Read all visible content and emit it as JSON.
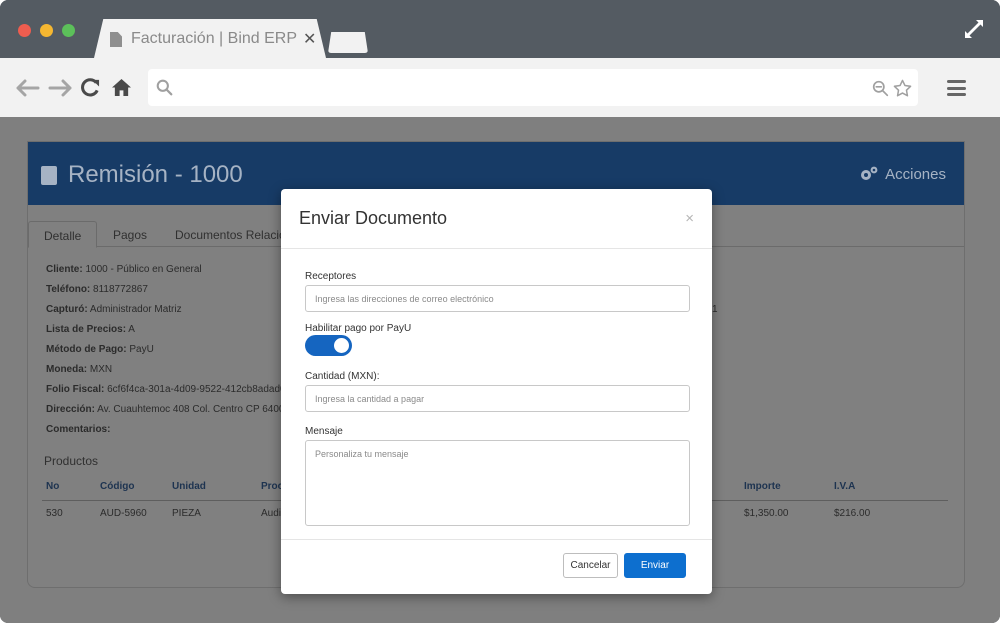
{
  "browser": {
    "tab_title": "Facturación | Bind ERP",
    "tab_close": "✕",
    "back_glyph": "⟵",
    "forward_glyph": "⟶",
    "reload_glyph": "↻",
    "home_glyph": "⌂",
    "search_glyph": "⚲",
    "zoom_glyph": "⊖",
    "star_glyph": "☆"
  },
  "page": {
    "title": "Remisión - 1000",
    "actions_label": "Acciones",
    "tabs": [
      {
        "label": "Detalle"
      },
      {
        "label": "Pagos"
      },
      {
        "label": "Documentos Relacio"
      }
    ],
    "info": [
      {
        "key": "Cliente:",
        "value": " 1000 - Público en General"
      },
      {
        "key": "Teléfono:",
        "value": " 8118772867"
      },
      {
        "key": "Capturó:",
        "value": " Administrador Matriz"
      },
      {
        "key": "Lista de Precios:",
        "value": " A"
      },
      {
        "key": "Método de Pago:",
        "value": " PayU"
      },
      {
        "key": "Moneda:",
        "value": " MXN"
      },
      {
        "key": "Folio Fiscal:",
        "value": " 6cf6f4ca-301a-4d09-9522-412cb8adad0"
      },
      {
        "key": "Dirección:",
        "value": " Av. Cuauhtemoc 408 Col. Centro CP 6400"
      },
      {
        "key": "Comentarios:",
        "value": ""
      }
    ],
    "right_fragment": "1",
    "products_title": "Productos",
    "table_headers": [
      "No",
      "Código",
      "Unidad",
      "Proc",
      "Importe",
      "I.V.A"
    ],
    "table_row": [
      "530",
      "AUD-5960",
      "PIEZA",
      "Audi",
      "$1,350.00",
      "$216.00"
    ]
  },
  "modal": {
    "title": "Enviar Documento",
    "close": "×",
    "recipients_label": "Receptores",
    "recipients_placeholder": "Ingresa las direcciones de correo electrónico",
    "payu_label": "Habilitar pago por PayU",
    "payu_enabled": true,
    "amount_label": "Cantidad (MXN):",
    "amount_placeholder": "Ingresa la cantidad a pagar",
    "message_label": "Mensaje",
    "message_placeholder": "Personaliza tu mensaje",
    "cancel_label": "Cancelar",
    "send_label": "Enviar"
  },
  "colors": {
    "accent": "#0d6fcf",
    "header_bg": "#173b66"
  }
}
